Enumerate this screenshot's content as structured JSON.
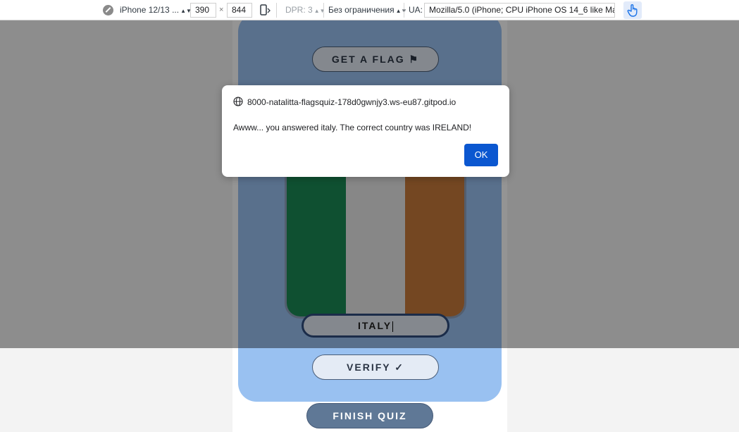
{
  "devtools": {
    "device": "iPhone 12/13 ...",
    "width": "390",
    "times": "×",
    "height": "844",
    "dpr": "DPR: 3",
    "throttle": "Без ограничения",
    "ua_label": "UA:",
    "ua_value": "Mozilla/5.0 (iPhone; CPU iPhone OS 14_6 like Mac"
  },
  "quiz": {
    "get_flag": "GET A FLAG",
    "flag_colors": [
      "#1a8a55",
      "#e8e8e8",
      "#c87a3b"
    ],
    "answer": "ITALY",
    "verify": "VERIFY",
    "finish": "FINISH QUIZ"
  },
  "dialog": {
    "origin": "8000-natalitta-flagsquiz-178d0gwnjy3.ws-eu87.gitpod.io",
    "message": "Awww... you answered italy. The correct country was IRELAND!",
    "ok": "OK"
  },
  "colors": {
    "card": "#99c1f1",
    "ok_button": "#0b57d0",
    "dark_button": "#5f7896"
  }
}
